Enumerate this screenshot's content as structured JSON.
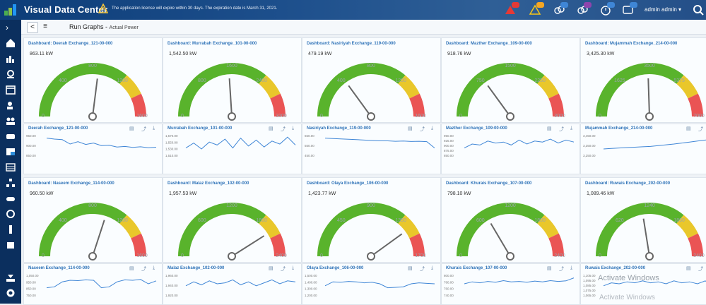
{
  "app": {
    "title": "Visual Data Center",
    "license_notice": "The application license will expire within 30 days. The expiration date is March 31, 2021.",
    "user": "admin admin",
    "badges": [
      "",
      "",
      "",
      "",
      "",
      "",
      ""
    ]
  },
  "subbar": {
    "back": "<",
    "menu": "≡",
    "title": "Run Graphs -",
    "subtitle": "Actual Power"
  },
  "cards": [
    {
      "title": "Dashboard: Deerah Exchange_121-00-000",
      "value": "863.11 kW",
      "max_label": "1600",
      "mid_label": "800",
      "l1": "400",
      "l2": "1200",
      "zero": "0",
      "needle": 0.54,
      "spark_title": "Deerah Exchange_121-00-000",
      "spark_ylabels": [
        "950.00",
        "900.00",
        "850.00"
      ],
      "spark": [
        0.8,
        0.75,
        0.72,
        0.5,
        0.62,
        0.48,
        0.55,
        0.42,
        0.44,
        0.35,
        0.38,
        0.33,
        0.36,
        0.31,
        0.34
      ]
    },
    {
      "title": "Dashboard: Murrabah Exchange_101-00-000",
      "value": "1,542.50 kW",
      "max_label": "3200",
      "mid_label": "1600",
      "l1": "800",
      "l2": "2400",
      "zero": "0",
      "needle": 0.48,
      "spark_title": "Murrabah Exchange_101-00-000",
      "spark_ylabels": [
        "1,570.00",
        "1,550.00",
        "1,530.00",
        "1,510.00"
      ],
      "spark": [
        0.3,
        0.55,
        0.25,
        0.6,
        0.45,
        0.75,
        0.3,
        0.8,
        0.4,
        0.7,
        0.35,
        0.65,
        0.5,
        0.85,
        0.45
      ]
    },
    {
      "title": "Dashboard: Nasiriyah Exchange_119-00-000",
      "value": "479.19 kW",
      "max_label": "1600",
      "mid_label": "800",
      "l1": "400",
      "l2": "1200",
      "zero": "0",
      "needle": 0.3,
      "spark_title": "Nasiriyah Exchange_119-00-000",
      "spark_ylabels": [
        "650.00",
        "550.00",
        "450.00"
      ],
      "spark": [
        0.8,
        0.78,
        0.76,
        0.74,
        0.72,
        0.7,
        0.68,
        0.66,
        0.66,
        0.64,
        0.65,
        0.63,
        0.64,
        0.62,
        0.3
      ]
    },
    {
      "title": "Dashboard: Mazther Exchange_109-00-000",
      "value": "918.76 kW",
      "max_label": "3000",
      "mid_label": "1500",
      "l1": "750",
      "l2": "2250",
      "zero": "0",
      "needle": 0.3,
      "spark_title": "Mazther Exchange_109-00-000",
      "spark_ylabels": [
        "950.00",
        "925.00",
        "900.00",
        "875.00",
        "850.00"
      ],
      "spark": [
        0.3,
        0.5,
        0.45,
        0.65,
        0.55,
        0.6,
        0.45,
        0.7,
        0.5,
        0.65,
        0.6,
        0.75,
        0.55,
        0.7,
        0.6
      ]
    },
    {
      "title": "Dashboard: Mujammah Exchange_214-00-000",
      "value": "3,425.30 kW",
      "max_label": "7000",
      "mid_label": "3500",
      "l1": "1625",
      "l2": "5375",
      "zero": "0",
      "needle": 0.49,
      "spark_title": "Mujammah Exchange_214-00-000",
      "spark_ylabels": [
        "3,450.00",
        "3,350.00",
        "3,250.00"
      ],
      "spark": [
        0.25,
        0.28,
        0.3,
        0.32,
        0.34,
        0.36,
        0.38,
        0.42,
        0.46,
        0.5,
        0.55,
        0.6,
        0.65,
        0.7,
        0.72
      ]
    },
    {
      "title": "Dashboard: Naseem Exchange_114-00-000",
      "value": "960.50 kW",
      "max_label": "1600",
      "mid_label": "800",
      "l1": "400",
      "l2": "1200",
      "zero": "0",
      "needle": 0.6,
      "spark_title": "Naseem Exchange_114-00-000",
      "spark_ylabels": [
        "1,050.00",
        "950.00",
        "850.00",
        "750.00"
      ],
      "spark": [
        0.3,
        0.35,
        0.6,
        0.68,
        0.66,
        0.7,
        0.68,
        0.3,
        0.35,
        0.6,
        0.7,
        0.68,
        0.72,
        0.5,
        0.65
      ]
    },
    {
      "title": "Dashboard: Malaz Exchange_102-00-000",
      "value": "1,957.53 kW",
      "max_label": "2400",
      "mid_label": "1200",
      "l1": "600",
      "l2": "1800",
      "zero": "0",
      "needle": 0.82,
      "spark_title": "Malaz Exchange_102-00-000",
      "spark_ylabels": [
        "1,960.00",
        "1,940.00",
        "1,920.00"
      ],
      "spark": [
        0.4,
        0.6,
        0.45,
        0.65,
        0.5,
        0.55,
        0.7,
        0.45,
        0.6,
        0.4,
        0.55,
        0.7,
        0.5,
        0.65,
        0.6
      ]
    },
    {
      "title": "Dashboard: Olaya Exchange_106-00-000",
      "value": "1,423.77 kW",
      "max_label": "1700",
      "mid_label": "900",
      "l1": "450",
      "l2": "1350",
      "zero": "0",
      "needle": 0.8,
      "spark_title": "Olaya Exchange_106-00-000",
      "spark_ylabels": [
        "1,500.00",
        "1,400.00",
        "1,300.00",
        "1,200.00"
      ],
      "spark": [
        0.4,
        0.6,
        0.58,
        0.62,
        0.6,
        0.55,
        0.58,
        0.5,
        0.3,
        0.32,
        0.35,
        0.5,
        0.55,
        0.52,
        0.5
      ]
    },
    {
      "title": "Dashboard: Khurais Exchange_107-00-000",
      "value": "798.10 kW",
      "max_label": "2400",
      "mid_label": "1200",
      "l1": "600",
      "l2": "1800",
      "zero": "0",
      "needle": 0.33,
      "spark_title": "Khurais Exchange_107-00-000",
      "spark_ylabels": [
        "800.00",
        "780.00",
        "760.00",
        "740.00"
      ],
      "spark": [
        0.5,
        0.6,
        0.55,
        0.62,
        0.58,
        0.66,
        0.6,
        0.62,
        0.58,
        0.64,
        0.6,
        0.66,
        0.62,
        0.65,
        0.8
      ]
    },
    {
      "title": "Dashboard: Ruwais Exchange_202-00-000",
      "value": "1,089.46 kW",
      "max_label": "2400",
      "mid_label": "1240",
      "l1": "620",
      "l2": "1860",
      "zero": "0",
      "needle": 0.45,
      "spark_title": "Ruwais Exchange_202-00-000",
      "spark_ylabels": [
        "1,105.00",
        "1,095.00",
        "1,085.00",
        "1,075.00",
        "1,065.00"
      ],
      "spark": [
        0.4,
        0.55,
        0.5,
        0.6,
        0.55,
        0.65,
        0.55,
        0.6,
        0.5,
        0.65,
        0.55,
        0.6,
        0.5,
        0.65,
        0.4
      ]
    }
  ],
  "watermark": {
    "title": "Activate Windows",
    "sub": "Activate Windows"
  },
  "colors": {
    "green": "#59b32c",
    "yellow": "#e9c72b",
    "red": "#ea5454",
    "line": "#3f86d6"
  }
}
